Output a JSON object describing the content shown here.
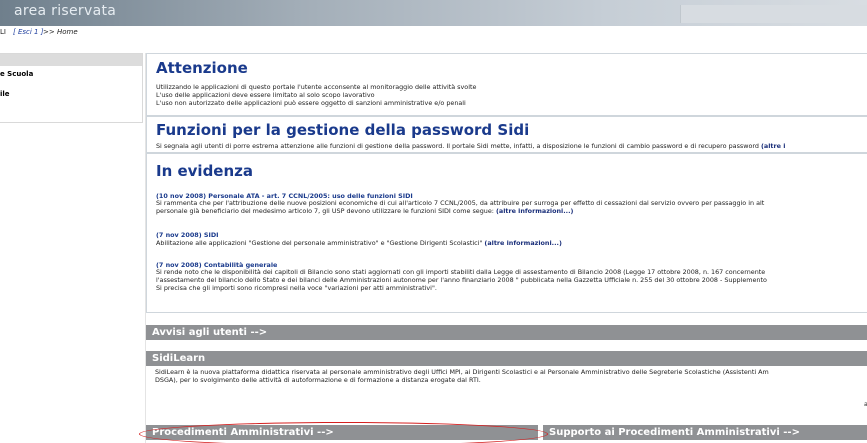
{
  "header": {
    "title": "area riservata"
  },
  "crumbs": {
    "user": "LI",
    "esci": "[ Esci 1 ]",
    "home": ">> Home"
  },
  "sidebar": {
    "items": [
      {
        "label": "e Scuola"
      },
      {
        "label": "ile"
      }
    ]
  },
  "attenzione": {
    "title": "Attenzione",
    "lines": [
      "Utilizzando le applicazioni di questo portale l'utente acconsente al monitoraggio delle attività svolte",
      "L'uso delle applicazioni deve essere limitato al solo scopo lavorativo",
      "L'uso non autorizzato delle applicazioni può essere oggetto di sanzioni amministrative e/o penali"
    ]
  },
  "password": {
    "title": "Funzioni per la gestione della password Sidi",
    "text": "Si segnala agli utenti di porre estrema attenzione alle funzioni di gestione della password. Il portale Sidi mette, infatti, a disposizione le funzioni di cambio password e di recupero password",
    "link": "(altre i"
  },
  "evidenza": {
    "title": "In evidenza",
    "news": [
      {
        "title": "(10 nov 2008) Personale ATA - art. 7 CCNL/2005: uso delle funzioni SIDI",
        "lines": [
          "Si rammenta che per l'attribuzione delle nuove posizioni economiche di cui all'articolo 7 CCNL/2005, da attribuire per surroga per effetto di cessazioni dal servizio ovvero per passaggio in alt",
          "personale già beneficiario del medesimo articolo 7, gli USP devono utilizzare le funzioni SIDI come segue:"
        ],
        "link": "(altre informazioni...)"
      },
      {
        "title": "(7 nov 2008) SIDI",
        "lines": [
          "Abilitazione alle applicazioni \"Gestione del personale amministrativo\" e \"Gestione Dirigenti Scolastici\""
        ],
        "link": "(altre informazioni...)"
      },
      {
        "title": "(7 nov 2008) Contabilità generale",
        "lines": [
          "Si rende noto che le disponibilità dei capitoli di Bilancio sono stati aggiornati con gli importi stabiliti dalla Legge di assestamento di Bilancio 2008 (Legge 17 ottobre 2008, n. 167 concernente",
          "l'assestamento del bilancio dello Stato e dei bilanci delle Amministrazioni autonome per l'anno finanziario 2008 \" pubblicata nella Gazzetta Ufficiale n. 255 del 30 ottobre 2008 - Supplemento",
          "Si precisa che gli importi sono ricompresi nella voce \"variazioni per atti amministrativi\"."
        ]
      }
    ]
  },
  "avvisi": {
    "label": "Avvisi agli utenti -->"
  },
  "sidilearn": {
    "label": "SidiLearn",
    "lines": [
      "SidiLearn è la nuova piattaforma didattica riservata al personale amministrativo degli Uffici MPI, ai Dirigenti Scolastici e al Personale Amministrativo delle Segreterie Scolastiche (Assistenti Am",
      "DSGA), per lo svolgimento delle attività di autoformazione e di formazione a distanza erogate dal RTI."
    ],
    "corner": "a"
  },
  "bottom": {
    "procedimenti": "Procedimenti Amministrativi -->",
    "supporto": "Supporto ai Procedimenti Amministrativi -->"
  },
  "colors": {
    "heading": "#1a3a8c",
    "graybar": "#8f9194",
    "highlight_oval": "#d42020"
  }
}
